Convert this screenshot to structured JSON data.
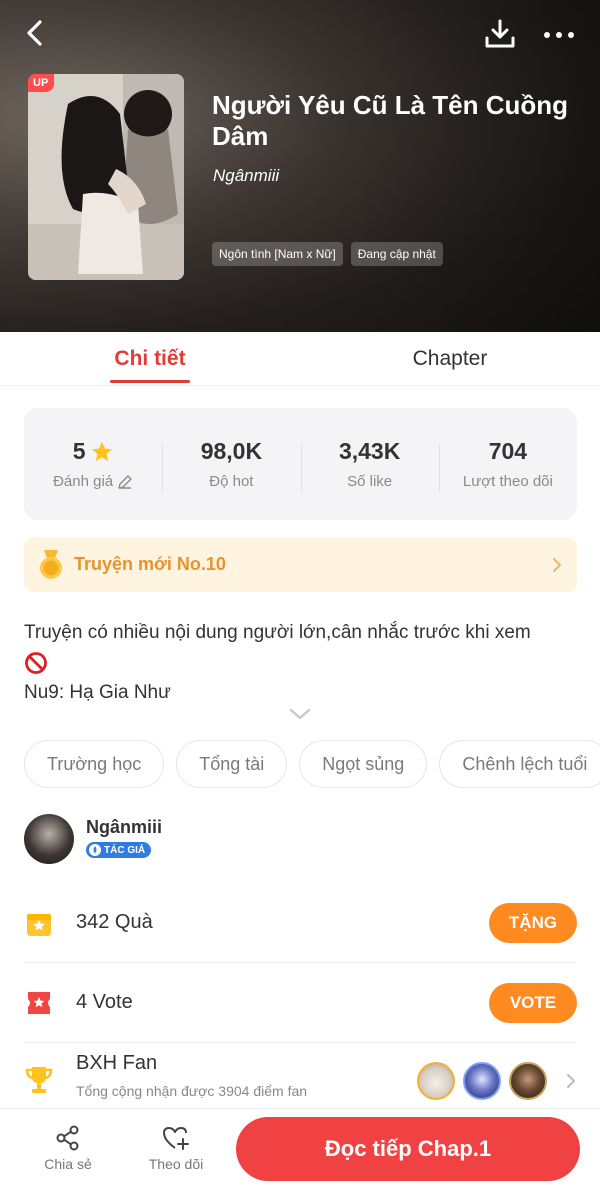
{
  "hero": {
    "up_badge": "UP",
    "title": "Người Yêu Cũ Là Tên Cuồng Dâm",
    "author": "Ngânmiii",
    "tags": [
      "Ngôn tình [Nam x Nữ]",
      "Đang cập nhật"
    ]
  },
  "tabs": [
    {
      "label": "Chi tiết",
      "active": true
    },
    {
      "label": "Chapter",
      "active": false
    }
  ],
  "stats": [
    {
      "value": "5",
      "label": "Đánh giá"
    },
    {
      "value": "98,0K",
      "label": "Độ hot"
    },
    {
      "value": "3,43K",
      "label": "Số like"
    },
    {
      "value": "704",
      "label": "Lượt theo dõi"
    }
  ],
  "rank": {
    "label": "Truyện mới No.10"
  },
  "description": {
    "line1": "Truyện có nhiều nội dung người lớn,cân nhắc trước khi xem",
    "line2": "Nu9: Hạ Gia Như"
  },
  "genres": [
    "Trường học",
    "Tổng tài",
    "Ngọt sủng",
    "Chênh lệch tuổi"
  ],
  "author_card": {
    "name": "Ngânmiii",
    "badge": "TÁC GIẢ"
  },
  "gift": {
    "label": "342 Quà",
    "button": "TẶNG"
  },
  "vote": {
    "label": "4 Vote",
    "button": "VOTE"
  },
  "fan": {
    "title": "BXH Fan",
    "subtitle": "Tổng cộng nhận được 3904 điểm fan"
  },
  "bottom": {
    "share": "Chia sẻ",
    "follow": "Theo dõi",
    "read": "Đọc tiếp Chap.1"
  },
  "colors": {
    "accent": "#e03c36",
    "orange": "#ff8a1f",
    "gold": "#e8932b",
    "read_button": "#f04242",
    "author_badge": "#2f7de1"
  },
  "icons": [
    "back-arrow-icon",
    "download-icon",
    "more-dots-icon",
    "star-icon",
    "pencil-icon",
    "medal-icon",
    "chevron-right-icon",
    "no-entry-icon",
    "chevron-down-icon",
    "drop-icon",
    "gift-icon",
    "ticket-icon",
    "trophy-icon",
    "share-icon",
    "heart-plus-icon"
  ]
}
